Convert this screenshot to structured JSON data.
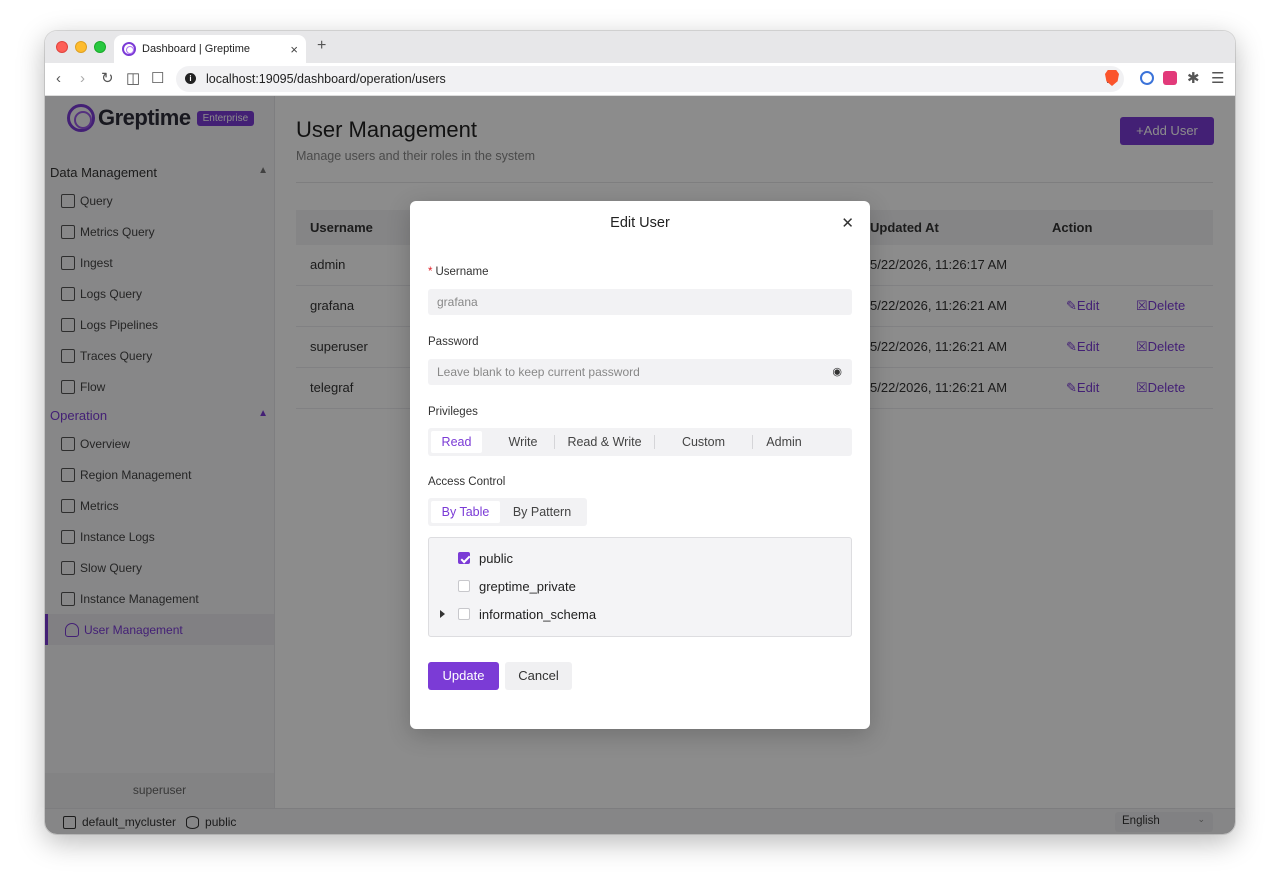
{
  "browser": {
    "tab_title": "Dashboard | Greptime",
    "url": "localhost:19095/dashboard/operation/users"
  },
  "app": {
    "logo_text": "Greptime",
    "logo_badge": "Enterprise",
    "sidebar": {
      "groups": [
        {
          "label": "Data Management",
          "items": [
            "Query",
            "Metrics Query",
            "Ingest",
            "Logs Query",
            "Logs Pipelines",
            "Traces Query",
            "Flow"
          ]
        },
        {
          "label": "Operation",
          "items": [
            "Overview",
            "Region Management",
            "Metrics",
            "Instance Logs",
            "Slow Query",
            "Instance Management",
            "User Management"
          ]
        }
      ],
      "selected": "User Management",
      "current_user": "superuser"
    },
    "status_bar": {
      "cluster": "default_mycluster",
      "database": "public",
      "language": "English"
    }
  },
  "page": {
    "title": "User Management",
    "subtitle": "Manage users and their roles in the system",
    "add_button": "+Add User"
  },
  "table": {
    "columns": [
      "Username",
      "Updated At",
      "Action"
    ],
    "rows": [
      {
        "username": "admin",
        "updated_at": "5/22/2026, 11:26:17 AM",
        "edit": "",
        "delete": ""
      },
      {
        "username": "grafana",
        "updated_at": "5/22/2026, 11:26:21 AM",
        "edit": "Edit",
        "delete": "Delete"
      },
      {
        "username": "superuser",
        "updated_at": "5/22/2026, 11:26:21 AM",
        "edit": "Edit",
        "delete": "Delete"
      },
      {
        "username": "telegraf",
        "updated_at": "5/22/2026, 11:26:21 AM",
        "edit": "Edit",
        "delete": "Delete"
      }
    ]
  },
  "modal": {
    "title": "Edit User",
    "username_label": "Username",
    "username_value": "grafana",
    "password_label": "Password",
    "password_placeholder": "Leave blank to keep current password",
    "privileges_label": "Privileges",
    "privileges": [
      "Read",
      "Write",
      "Read & Write",
      "Custom",
      "Admin"
    ],
    "privilege_selected": "Read",
    "access_label": "Access Control",
    "access_modes": [
      "By Table",
      "By Pattern"
    ],
    "access_selected": "By Table",
    "tree": [
      {
        "label": "public",
        "checked": true,
        "expandable": false
      },
      {
        "label": "greptime_private",
        "checked": false,
        "expandable": false
      },
      {
        "label": "information_schema",
        "checked": false,
        "expandable": true
      }
    ],
    "update_button": "Update",
    "cancel_button": "Cancel"
  },
  "colors": {
    "accent": "#7b3bd6",
    "overlay": "rgba(0,0,0,0.45)"
  }
}
